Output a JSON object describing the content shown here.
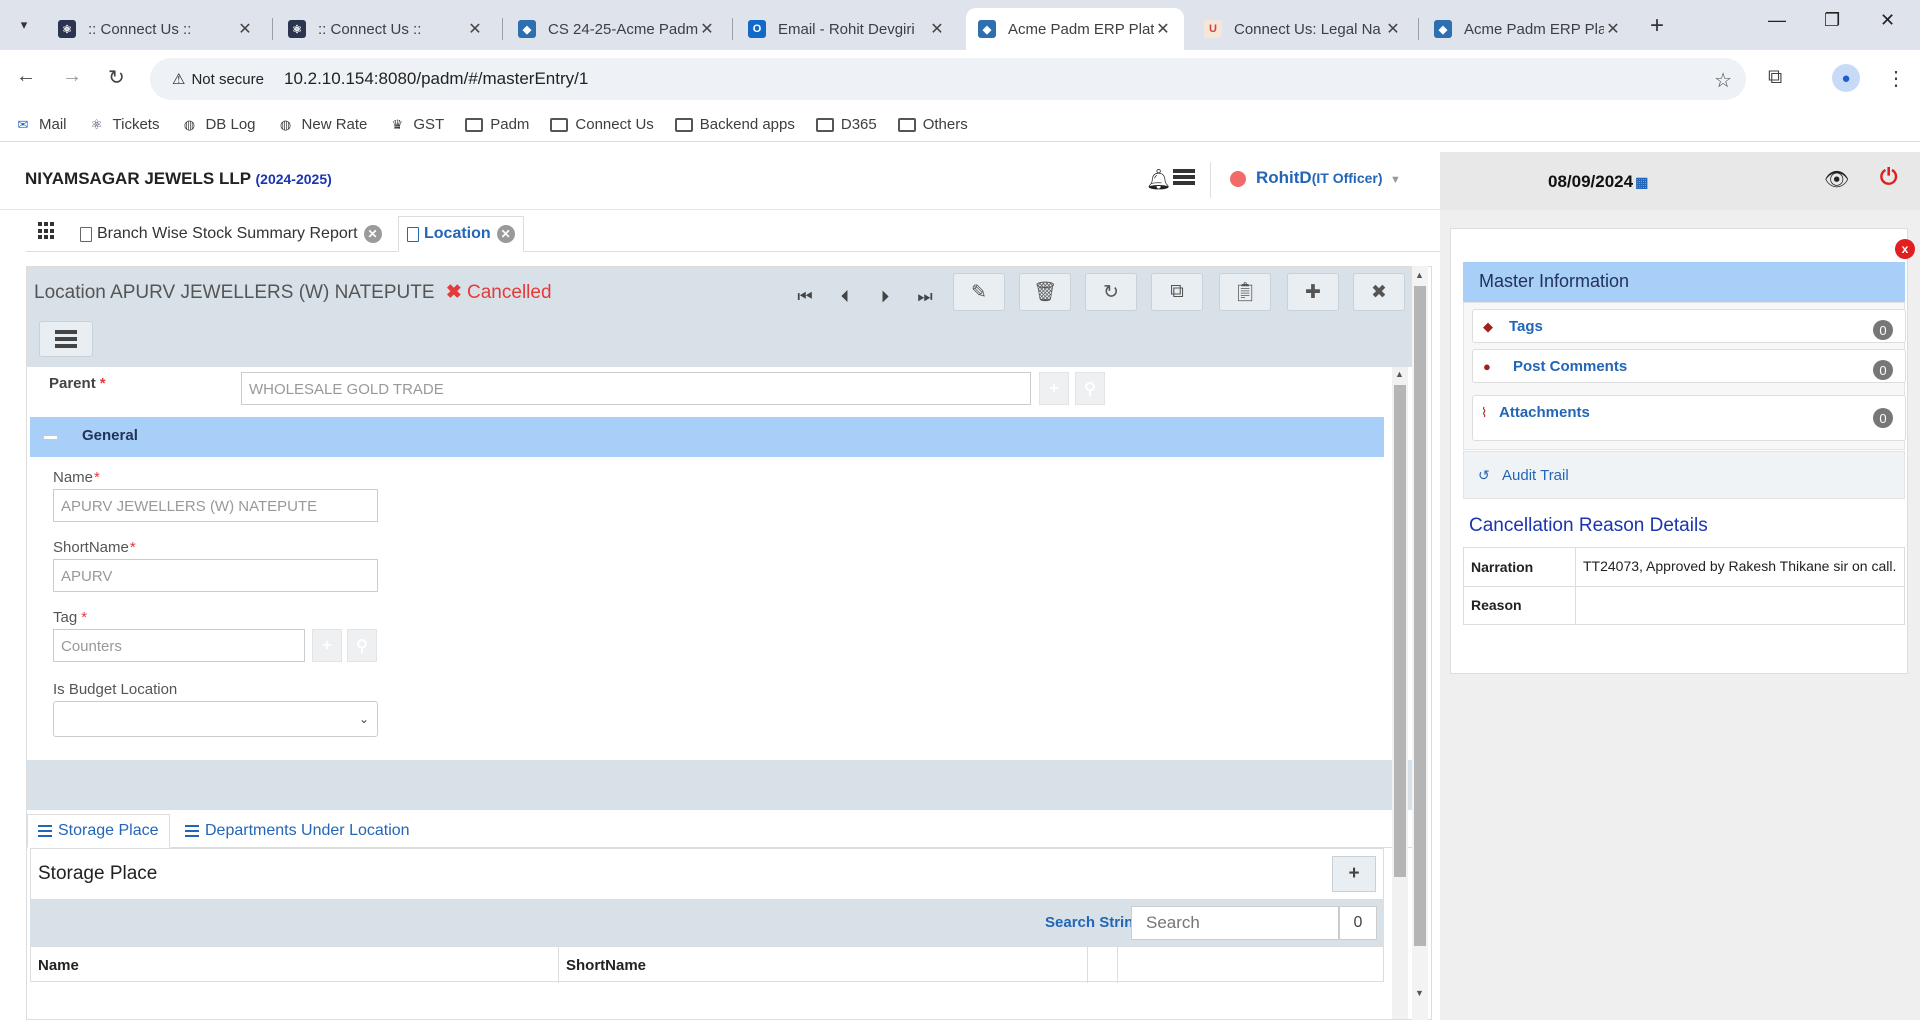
{
  "browser": {
    "tabs": [
      {
        "title": ":: Connect Us ::",
        "active": false
      },
      {
        "title": ":: Connect Us ::",
        "active": false
      },
      {
        "title": "CS 24-25-Acme Padm",
        "active": false
      },
      {
        "title": "Email - Rohit Devgiri",
        "active": false
      },
      {
        "title": "Acme Padm ERP Plat",
        "active": true
      },
      {
        "title": "Connect Us: Legal Na",
        "active": false
      },
      {
        "title": "Acme Padm ERP Plat",
        "active": false
      }
    ],
    "security_label": "Not secure",
    "url": "10.2.10.154:8080/padm/#/masterEntry/1",
    "bookmarks": [
      {
        "label": "Mail",
        "icon": "mail-icon"
      },
      {
        "label": "Tickets",
        "icon": "tickets-icon"
      },
      {
        "label": "DB Log",
        "icon": "globe-icon"
      },
      {
        "label": "New Rate",
        "icon": "globe-icon"
      },
      {
        "label": "GST",
        "icon": "emblem-icon"
      },
      {
        "label": "Padm",
        "icon": "folder-icon"
      },
      {
        "label": "Connect Us",
        "icon": "folder-icon"
      },
      {
        "label": "Backend apps",
        "icon": "folder-icon"
      },
      {
        "label": "D365",
        "icon": "folder-icon"
      },
      {
        "label": "Others",
        "icon": "folder-icon"
      }
    ]
  },
  "header": {
    "company": "NIYAMSAGAR JEWELS LLP",
    "year": "(2024-2025)",
    "user": "RohitD",
    "role": "(IT Officer)",
    "date": "08/09/2024"
  },
  "app_tabs": [
    {
      "label": "Branch Wise Stock Summary Report",
      "active": false
    },
    {
      "label": "Location",
      "active": true
    }
  ],
  "form": {
    "title": "Location APURV JEWELLERS (W) NATEPUTE",
    "status": "Cancelled",
    "parent": {
      "label": "Parent",
      "required": "*",
      "value": "WHOLESALE GOLD TRADE"
    },
    "section_general": "General",
    "fields": {
      "name": {
        "label": "Name",
        "required": "*",
        "value": "APURV JEWELLERS (W) NATEPUTE"
      },
      "short_name": {
        "label": "ShortName",
        "required": "*",
        "value": "APURV"
      },
      "tag": {
        "label": "Tag",
        "required": "*",
        "value": "Counters"
      },
      "is_budget_location": {
        "label": "Is Budget Location",
        "value": ""
      }
    }
  },
  "sub_tabs": [
    {
      "label": "Storage Place",
      "active": true
    },
    {
      "label": "Departments Under Location",
      "active": false
    }
  ],
  "storage_place": {
    "title": "Storage Place",
    "search_label": "Search String :",
    "search_placeholder": "Search",
    "count": "0",
    "columns": [
      "Name",
      "ShortName"
    ]
  },
  "master_info": {
    "title": "Master Information",
    "items": [
      {
        "label": "Tags",
        "count": "0"
      },
      {
        "label": "Post Comments",
        "count": "0"
      },
      {
        "label": "Attachments",
        "count": "0"
      }
    ],
    "audit_trail": "Audit Trail",
    "close_label": "x"
  },
  "cancellation": {
    "title": "Cancellation Reason Details",
    "rows": [
      {
        "key": "Narration",
        "value": "TT24073, Approved by Rakesh Thikane sir on call."
      },
      {
        "key": "Reason",
        "value": ""
      }
    ]
  },
  "colors": {
    "accent_blue": "#2366b7",
    "section_blue": "#a7cff8",
    "danger_red": "#e53a3a",
    "toolbar_gray": "#d8e1e8"
  }
}
